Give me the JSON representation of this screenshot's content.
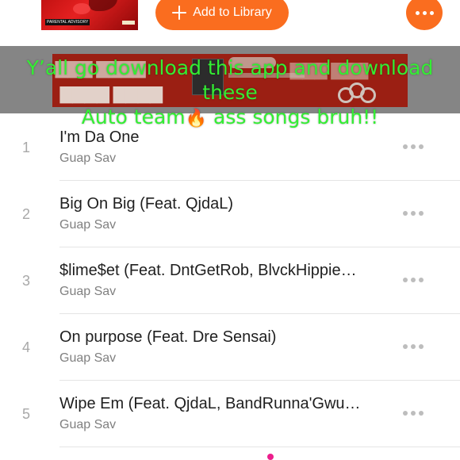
{
  "header": {
    "album_art_label": "PARENTAL ADVISORY",
    "add_to_library_label": "Add to Library",
    "accent_color": "#fa6d1f"
  },
  "promo": {
    "caption_line1": "Y’all go download this app and download these",
    "caption_line2_pre": "Auto team",
    "caption_flame": "🔥",
    "caption_line2_post": "ass songs bruh!!",
    "caption_color": "#33ee33"
  },
  "tracks": [
    {
      "number": "1",
      "title": "I'm Da One",
      "artist": "Guap Sav"
    },
    {
      "number": "2",
      "title": "Big On Big (Feat. QjdaL)",
      "artist": "Guap Sav"
    },
    {
      "number": "3",
      "title": "$lime$et (Feat. DntGetRob, BlvckHippie…",
      "artist": "Guap Sav"
    },
    {
      "number": "4",
      "title": "On purpose (Feat. Dre Sensai)",
      "artist": "Guap Sav"
    },
    {
      "number": "5",
      "title": "Wipe Em (Feat. QjdaL, BandRunna'Gwu…",
      "artist": "Guap Sav"
    }
  ],
  "icons": {
    "add": "plus-icon",
    "more": "more-horizontal-icon"
  },
  "page_indicator_color": "#ec1e8c"
}
